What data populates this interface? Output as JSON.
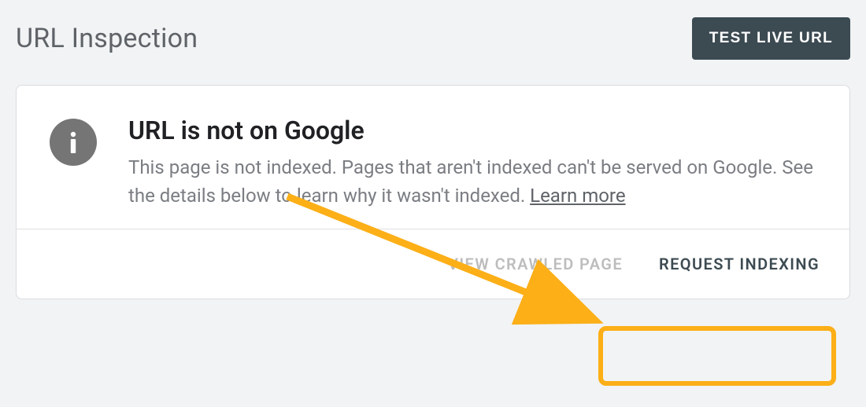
{
  "header": {
    "title": "URL Inspection",
    "test_button": "TEST LIVE URL"
  },
  "card": {
    "heading": "URL is not on Google",
    "description": "This page is not indexed. Pages that aren't indexed can't be served on Google. See the details below to learn why it wasn't indexed.",
    "learn_more": "Learn more"
  },
  "footer": {
    "view_crawled": "VIEW CRAWLED PAGE",
    "request_indexing": "REQUEST INDEXING"
  },
  "colors": {
    "annotation": "#fcaf17",
    "header_btn_bg": "#3c4a52",
    "text_muted": "#5f6368",
    "disabled": "#bdbdbd"
  }
}
